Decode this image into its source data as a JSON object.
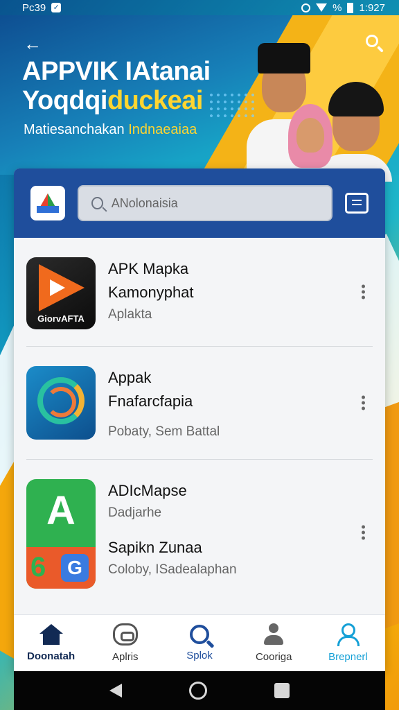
{
  "status_bar": {
    "time_left": "Pc39",
    "battery_text": "%",
    "time_right": "1:927"
  },
  "hero": {
    "title_line1": "APPVIK IAtanai",
    "title_line2_a": "Yoqdqi",
    "title_line2_b": "duckeai",
    "subtitle_a": "Matiesanchakan",
    "subtitle_b": "Indnaeaiaa"
  },
  "header": {
    "search_placeholder": "ANolonaisia"
  },
  "apps": [
    {
      "title": "APK Mapka",
      "title2": "Kamonyphat",
      "subtitle": "Aplakta",
      "icon_caption": "GiorvAFTA"
    },
    {
      "title": "Appak",
      "title2": "Fnafarcfapia",
      "subtitle": "Pobaty, Sem Battal"
    },
    {
      "title": "ADIcMapse",
      "title2": "Dadjarhe",
      "title3": "Sapikn Zunaa",
      "subtitle": "Coloby, ISadealaphan",
      "icon_letter": "A",
      "icon_six": "6",
      "icon_g": "G"
    }
  ],
  "nav": {
    "home": "Doonatah",
    "apps": "Aplris",
    "search": "Splok",
    "people": "Coorigа",
    "profile": "Brepnerl"
  },
  "colors": {
    "header_blue": "#1f4e9c",
    "accent_yellow": "#ffd531",
    "active_profile": "#15a0d6"
  }
}
